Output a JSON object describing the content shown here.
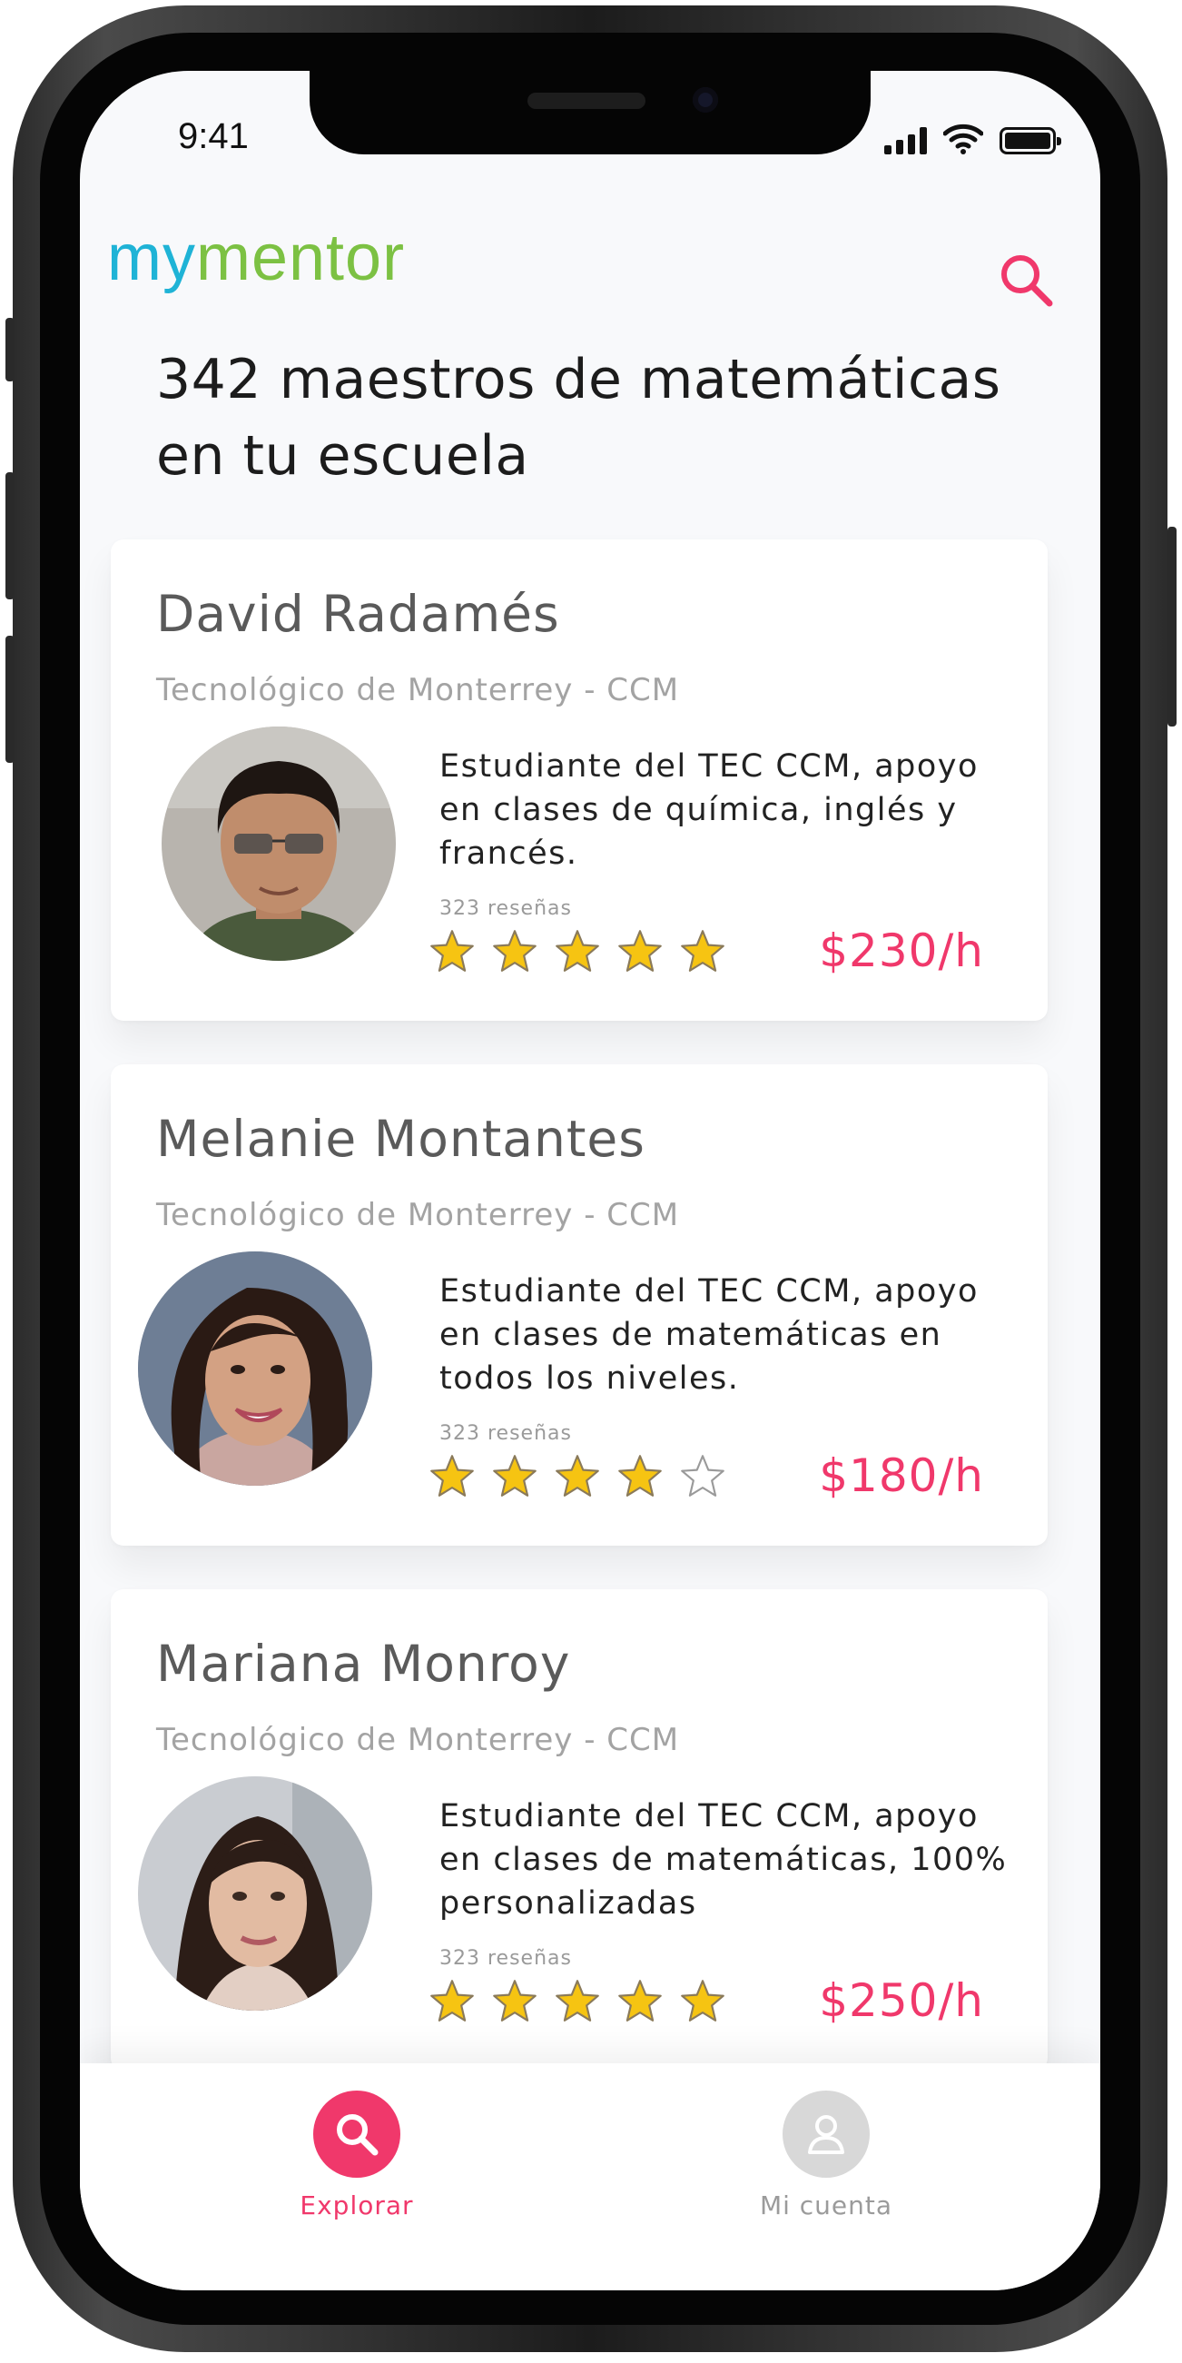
{
  "status_bar": {
    "time": "9:41"
  },
  "header": {
    "logo_part1": "my",
    "logo_part2": "mentor",
    "search_icon": "search-icon",
    "headline": "342 maestros de matemáticas en tu escuela"
  },
  "mentors": [
    {
      "name": "David Radamés",
      "school": "Tecnológico de Monterrey - CCM",
      "description": "Estudiante del TEC CCM, apoyo en clases de química, inglés y francés.",
      "reviews": "323 reseñas",
      "rating": 5,
      "price": "$230/h"
    },
    {
      "name": "Melanie Montantes",
      "school": "Tecnológico de Monterrey - CCM",
      "description": "Estudiante del TEC CCM, apoyo en clases de matemáticas en todos los niveles.",
      "reviews": "323 reseñas",
      "rating": 4,
      "price": "$180/h"
    },
    {
      "name": "Mariana Monroy",
      "school": "Tecnológico de Monterrey - CCM",
      "description": "Estudiante del TEC CCM, apoyo en clases de matemáticas, 100% personalizadas",
      "reviews": "323 reseñas",
      "rating": 5,
      "price": "$250/h"
    }
  ],
  "bottom_nav": [
    {
      "label": "Explorar",
      "icon": "search-icon",
      "active": true
    },
    {
      "label": "Mi cuenta",
      "icon": "user-icon",
      "active": false
    }
  ],
  "colors": {
    "accent": "#f0386b",
    "logo_blue": "#1fb3d6",
    "logo_green": "#7cc143",
    "star_fill": "#f6c412",
    "inactive": "#d8d8d8"
  }
}
